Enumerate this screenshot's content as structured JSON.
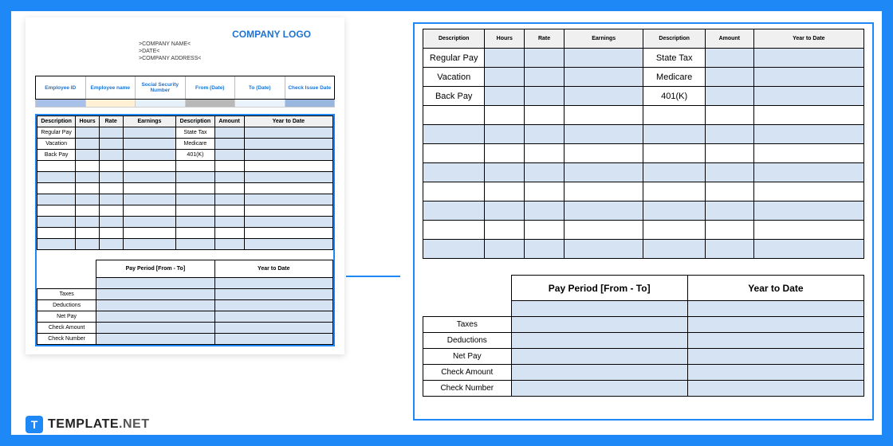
{
  "logo": "COMPANY LOGO",
  "meta": {
    "company": ">COMPANY NAME<",
    "date": ">DATE<",
    "address": ">COMPANY ADDRESS<"
  },
  "info": {
    "emp_id": "Employee ID",
    "emp_name": "Employee name",
    "ssn": "Social Security Number",
    "from": "From (Date)",
    "to": "To (Date)",
    "check": "Check Issue Date"
  },
  "pay": {
    "desc": "Description",
    "hours": "Hours",
    "rate": "Rate",
    "earnings": "Earnings",
    "desc2": "Description",
    "amount": "Amount",
    "ytd": "Year to Date",
    "rows": [
      "Regular Pay",
      "Vacation",
      "Back Pay"
    ],
    "ded": [
      "State Tax",
      "Medicare",
      "401(K)"
    ]
  },
  "summary": {
    "pp": "Pay Period [From - To]",
    "ytd": "Year to Date",
    "labels": [
      "Taxes",
      "Deductions",
      "Net Pay",
      "Check Amount",
      "Check Number"
    ]
  },
  "brand": {
    "t": "TEMPLATE",
    "net": ".NET"
  }
}
